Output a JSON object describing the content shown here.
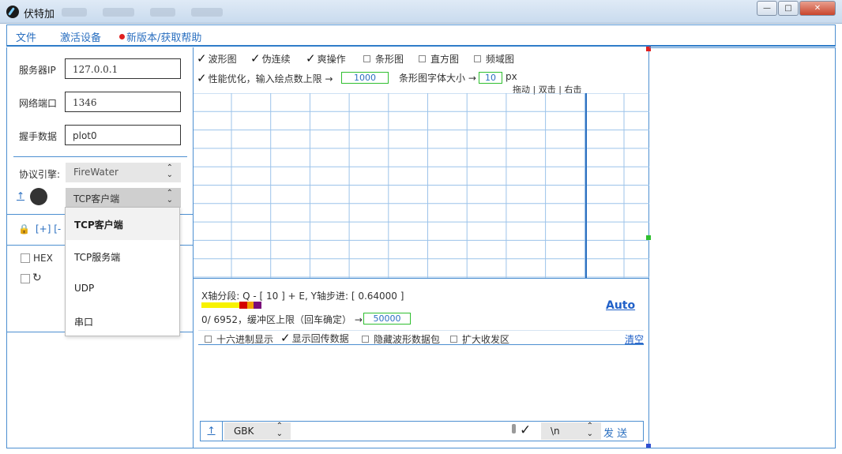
{
  "window": {
    "title": "伏特加"
  },
  "menu": {
    "file": "文件",
    "activate": "激活设备",
    "update": "新版本/获取帮助"
  },
  "connection": {
    "server_ip_label": "服务器IP",
    "server_ip": "127.0.0.1",
    "port_label": "网络端口",
    "port": "1346",
    "handshake_label": "握手数据",
    "handshake": "plot0",
    "protocol_label": "协议引擎:",
    "protocol": "FireWater",
    "transport": "TCP客户端",
    "transport_options": [
      "TCP客户端",
      "TCP服务端",
      "UDP",
      "串口"
    ]
  },
  "left_lower": {
    "cmd_add": "[+]  [-",
    "hex_label": "HEX"
  },
  "plot_options": {
    "items": [
      {
        "label": "波形图",
        "checked": true
      },
      {
        "label": "伪连续",
        "checked": true
      },
      {
        "label": "爽操作",
        "checked": true
      },
      {
        "label": "条形图",
        "checked": false
      },
      {
        "label": "直方图",
        "checked": false
      },
      {
        "label": "频域图",
        "checked": false
      }
    ],
    "perf_label": "性能优化，输入绘点数上限 →",
    "perf_value": "1000",
    "bar_font_label": "条形图字体大小 →",
    "bar_font_value": "10",
    "bar_font_unit": "px",
    "hint": "拖动 | 双击 | 右击"
  },
  "axis_info": {
    "text": "X轴分段: Q - [ 10 ] + E,  Y轴步进: [ 0.64000 ]",
    "auto_label": "Auto",
    "buffer_text": "0/ 6952，缓冲区上限（回车确定） →",
    "buffer_value": "50000"
  },
  "display_options": {
    "hex_display": "十六进制显示",
    "show_echo": "显示回传数据",
    "hide_packets": "隐藏波形数据包",
    "expand_rx": "扩大收发区",
    "clear": "清空"
  },
  "send_bar": {
    "encoding": "GBK",
    "line_ending": "\\n",
    "send_label": "发 送"
  },
  "colors": {
    "accent": "#2a6fc0",
    "border": "#4d8fd1",
    "grid": "#9cc3ea",
    "green": "#2fbf2f",
    "record": "#e02020"
  }
}
